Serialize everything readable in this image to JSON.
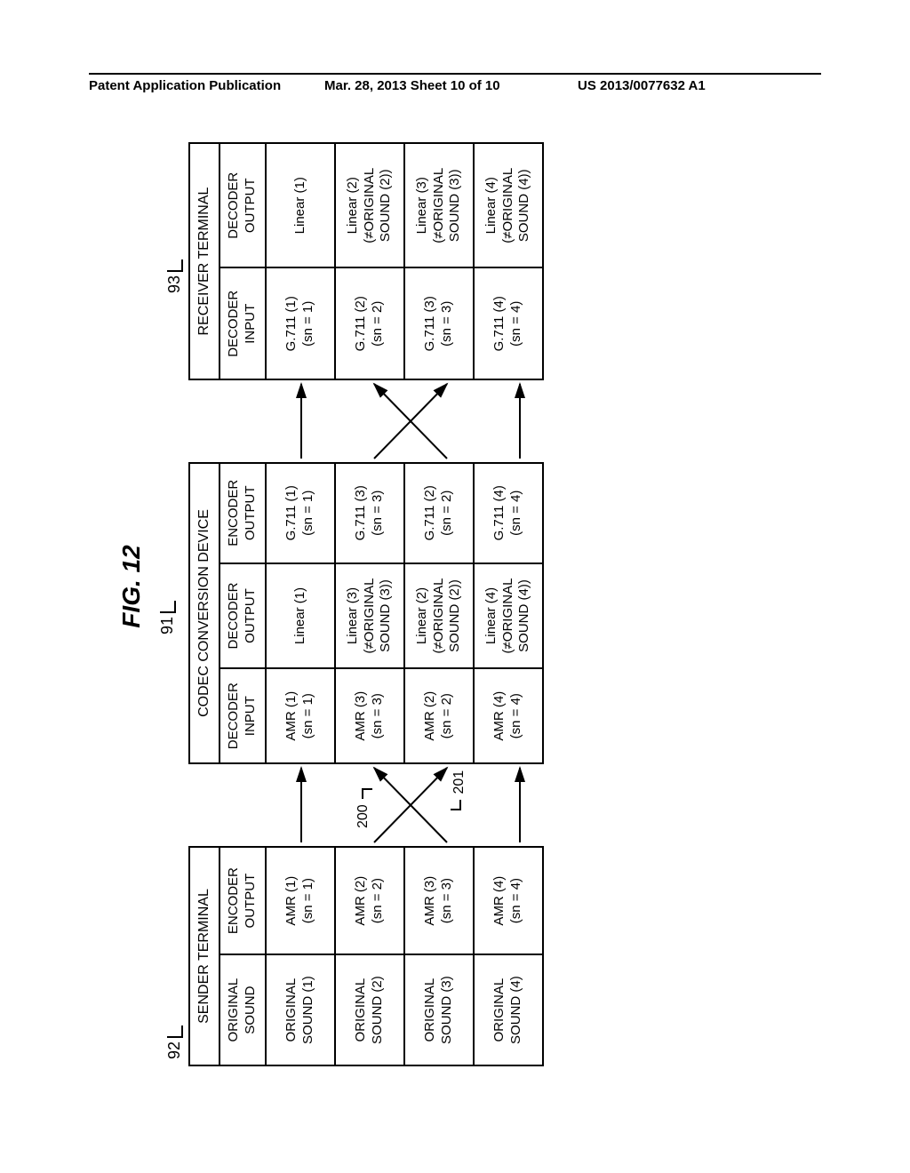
{
  "header": {
    "left": "Patent Application Publication",
    "center": "Mar. 28, 2013  Sheet 10 of 10",
    "right": "US 2013/0077632 A1"
  },
  "figure": {
    "title": "FIG. 12",
    "labels": {
      "sender_ref": "92",
      "codec_ref": "91",
      "receiver_ref": "93",
      "cross_a": "200",
      "cross_b": "201"
    },
    "sender": {
      "group": "SENDER TERMINAL",
      "cols": [
        "ORIGINAL SOUND",
        "ENCODER OUTPUT"
      ],
      "rows": [
        {
          "c0": "ORIGINAL SOUND (1)",
          "c1": "AMR (1)\n(sn = 1)"
        },
        {
          "c0": "ORIGINAL SOUND (2)",
          "c1": "AMR (2)\n(sn = 2)"
        },
        {
          "c0": "ORIGINAL SOUND (3)",
          "c1": "AMR (3)\n(sn = 3)"
        },
        {
          "c0": "ORIGINAL SOUND (4)",
          "c1": "AMR (4)\n(sn = 4)"
        }
      ]
    },
    "codec": {
      "group": "CODEC CONVERSION DEVICE",
      "cols": [
        "DECODER INPUT",
        "DECODER OUTPUT",
        "ENCODER OUTPUT"
      ],
      "rows": [
        {
          "c0": "AMR (1)\n(sn = 1)",
          "c1": "Linear (1)",
          "c2": "G.711 (1)\n(sn = 1)"
        },
        {
          "c0": "AMR (3)\n(sn = 3)",
          "c1": "Linear (3)\n(≠ORIGINAL\nSOUND (3))",
          "c2": "G.711 (3)\n(sn = 3)"
        },
        {
          "c0": "AMR (2)\n(sn = 2)",
          "c1": "Linear (2)\n(≠ORIGINAL\nSOUND (2))",
          "c2": "G.711 (2)\n(sn = 2)"
        },
        {
          "c0": "AMR (4)\n(sn = 4)",
          "c1": "Linear (4)\n(≠ORIGINAL\nSOUND (4))",
          "c2": "G.711 (4)\n(sn = 4)"
        }
      ]
    },
    "receiver": {
      "group": "RECEIVER TERMINAL",
      "cols": [
        "DECODER INPUT",
        "DECODER OUTPUT"
      ],
      "rows": [
        {
          "c0": "G.711 (1)\n(sn = 1)",
          "c1": "Linear (1)"
        },
        {
          "c0": "G.711 (2)\n(sn = 2)",
          "c1": "Linear (2)\n(≠ORIGINAL\nSOUND (2))"
        },
        {
          "c0": "G.711 (3)\n(sn = 3)",
          "c1": "Linear (3)\n(≠ORIGINAL\nSOUND (3))"
        },
        {
          "c0": "G.711 (4)\n(sn = 4)",
          "c1": "Linear (4)\n(≠ORIGINAL\nSOUND (4))"
        }
      ]
    }
  }
}
